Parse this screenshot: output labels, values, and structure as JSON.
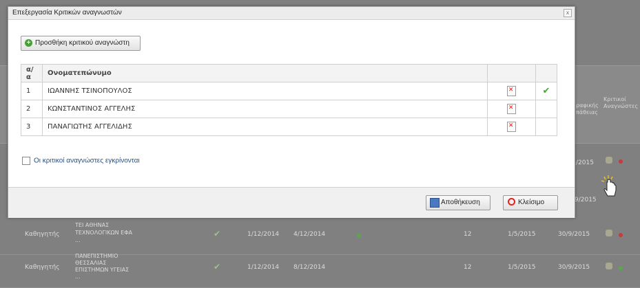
{
  "modal": {
    "title": "Επεξεργασία Κριτικών αναγνωστών",
    "close_symbol": "x",
    "add_button": "Προσθήκη κριτικού αναγνώστη",
    "table": {
      "headers": [
        "α/α",
        "Ονοματεπώνυμο",
        "",
        ""
      ],
      "rows": [
        {
          "num": "1",
          "name": "ΙΩΑΝΝΗΣ ΤΣΙΝΟΠΟΥΛΟΣ",
          "approved": true
        },
        {
          "num": "2",
          "name": "ΚΩΝΣΤΑΝΤΙΝΟΣ ΑΓΓΕΛΗΣ",
          "approved": false
        },
        {
          "num": "3",
          "name": "ΠΑΝΑΓΙΩΤΗΣ ΑΓΓΕΛΙΔΗΣ",
          "approved": false
        }
      ]
    },
    "approve_checkbox_label": "Οι κριτικοί αναγνώστες εγκρίνονται",
    "save_button": "Αποθήκευση",
    "close_button": "Κλείσιμο"
  },
  "background": {
    "header_fragments": [
      "ραφικής",
      "πάθειας",
      "Κριτικοί",
      "Αναγνώστες"
    ],
    "visible_dates": [
      "/2015",
      "9/2015"
    ],
    "rows": [
      {
        "role": "Καθηγητής",
        "institution": [
          "ΤΕΙ ΑΘΗΝΑΣ",
          "ΤΕΧΝΟΛΟΓΙΚΩΝ ΕΦΑ",
          "..."
        ],
        "date1": "1/12/2014",
        "date2": "4/12/2014",
        "count": "12",
        "date3": "1/5/2015",
        "date4": "30/9/2015",
        "status_color": "#c93a3a",
        "dot_color": "#5aa84a"
      },
      {
        "role": "Καθηγητής",
        "institution": [
          "ΠΑΝΕΠΙΣΤΗΜΙΟ",
          "ΘΕΣΣΑΛΙΑΣ",
          "ΕΠΙΣΤΗΜΩΝ ΥΓΕΙΑΣ",
          "..."
        ],
        "date1": "1/12/2014",
        "date2": "8/12/2014",
        "count": "12",
        "date3": "1/5/2015",
        "date4": "30/9/2015",
        "status_color": "#5aa84a",
        "dot_color": ""
      }
    ]
  },
  "colors": {
    "ok_green": "#4aa33a",
    "delete_red": "#d22222",
    "link_blue": "#1f4f8a"
  }
}
